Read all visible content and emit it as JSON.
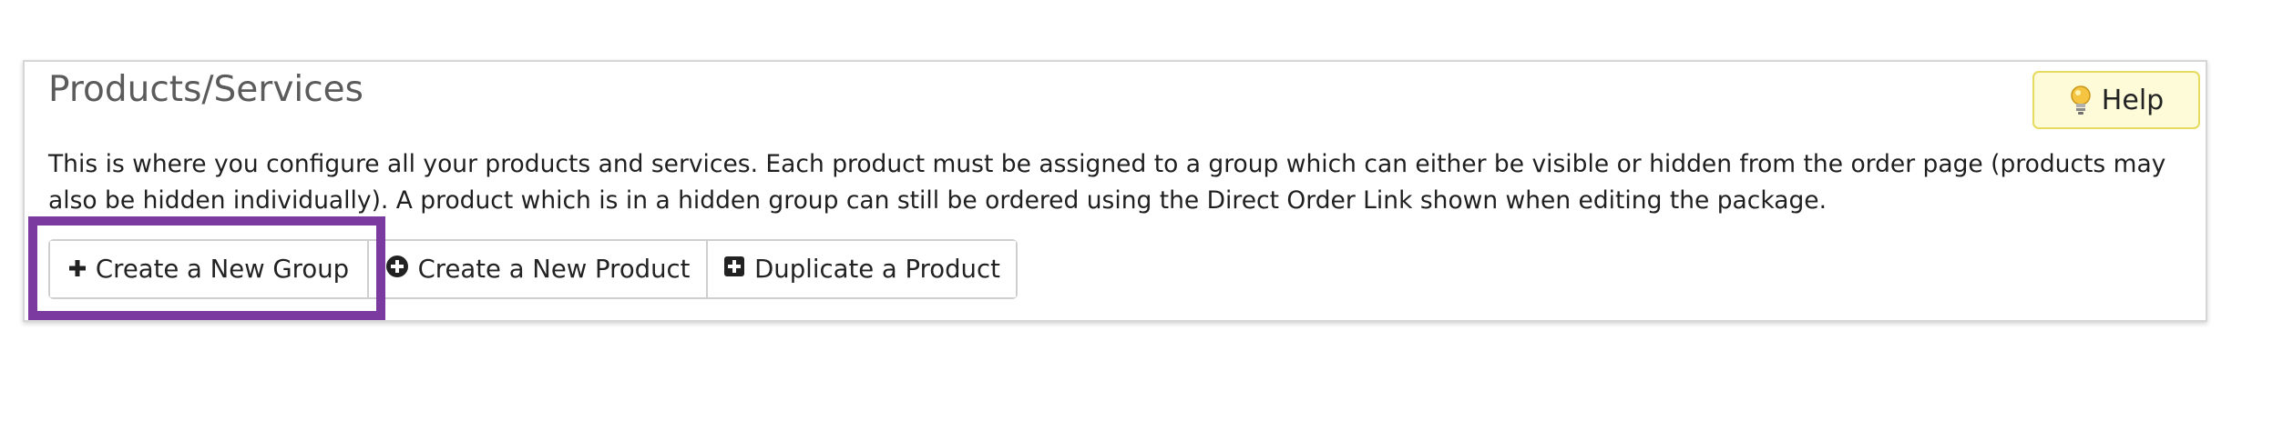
{
  "header": {
    "title": "Products/Services",
    "help_label": "Help"
  },
  "description": "This is where you configure all your products and services. Each product must be assigned to a group which can either be visible or hidden from the order page (products may also be hidden individually). A product which is in a hidden group can still be ordered using the Direct Order Link shown when editing the package.",
  "actions": {
    "create_group_label": "Create a New Group",
    "create_product_label": "Create a New Product",
    "duplicate_product_label": "Duplicate a Product"
  },
  "icons": {
    "help": "lightbulb-icon",
    "create_group": "plus-icon",
    "create_product": "plus-circle-icon",
    "duplicate_product": "plus-square-icon"
  },
  "colors": {
    "help_background": "#fdfbd8",
    "help_border": "#e6db5e",
    "highlight": "#7b3aa0",
    "title_text": "#5b5b5b"
  }
}
